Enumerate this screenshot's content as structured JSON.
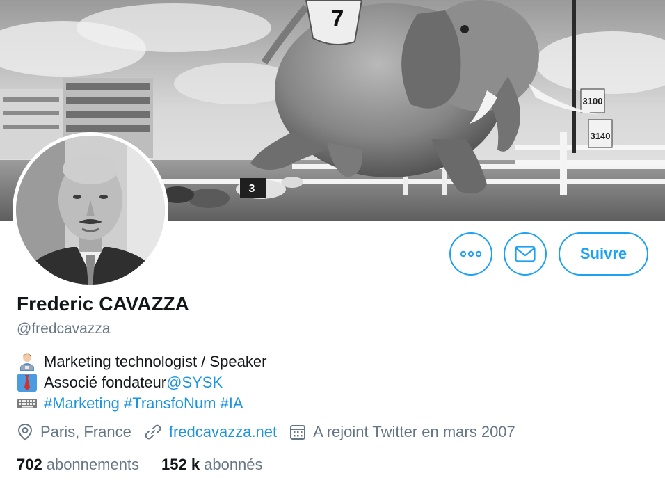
{
  "profile": {
    "name": "Frederic CAVAZZA",
    "handle": "@fredcavazza",
    "follow_label": "Suivre"
  },
  "bio": {
    "line1": {
      "text": "Marketing technologist / Speaker",
      "emoji": "technologist-emoji"
    },
    "line2": {
      "text": "Associé fondateur ",
      "mention": "@SYSK",
      "emoji": "necktie-emoji"
    },
    "line3": {
      "hashtags": [
        "#Marketing",
        "#TransfoNum",
        "#IA"
      ],
      "emoji": "keyboard-emoji"
    }
  },
  "meta": {
    "location": "Paris, France",
    "website": "fredcavazza.net",
    "joined": "A rejoint Twitter en mars 2007"
  },
  "stats": {
    "following_count": "702",
    "following_label": "abonnements",
    "followers_count": "152 k",
    "followers_label": "abonnés"
  },
  "banner": {
    "saddle_number": "7",
    "dog_number": "3",
    "distance_sign_1": "3100",
    "distance_sign_2": "3140"
  },
  "colors": {
    "accent": "#1da1f2",
    "link": "#1b95e0",
    "secondary_text": "#657786",
    "primary_text": "#14171a"
  }
}
